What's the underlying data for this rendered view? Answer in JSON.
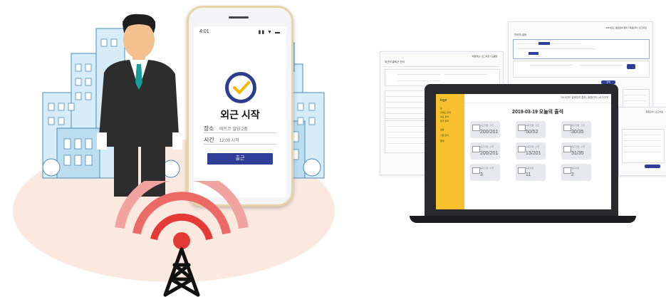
{
  "colors": {
    "ground": "#fbe9e0",
    "signal": "#e53935",
    "phone_accent": "#2f3f99",
    "sidebar": "#f6c12c",
    "building": "#cfe6f5",
    "building_outline": "#4a8bb8"
  },
  "phone": {
    "time": "4:01",
    "status_icons": "▮▮ ▼ ▬",
    "title": "외근 시작",
    "place_label": "장소",
    "place_value": "비트코 빌딩 2층",
    "time_label": "시간",
    "time_value": "12:00 시작",
    "button_label": "출근"
  },
  "laptop": {
    "logo": "logo",
    "topbar": "2019년도 설문참여 결과 | 회원관리 | 로그아웃",
    "date_title": "2019-03-19 오늘의 출석",
    "sidebar_items": [
      "홈",
      "출퇴근 관리",
      "외근 관리",
      "휴가 관리",
      "설정",
      "사원 관리",
      "통계"
    ],
    "cards": [
      {
        "title": "출근 현황 · 수업",
        "value": "200/201"
      },
      {
        "title": "지각 현황 · 수업",
        "value": "50/52"
      },
      {
        "title": "결근 현황 · 수업",
        "value": "30/35"
      },
      {
        "title": "퇴근 현황 · 수업",
        "value": "200/201"
      },
      {
        "title": "조퇴 현황 · 수업",
        "value": "13/201"
      },
      {
        "title": "외근 현황 · 수업",
        "value": "31/35"
      },
      {
        "title": "휴가 신청 · 수업",
        "value": "3"
      },
      {
        "title": "출장 현황",
        "value": "11"
      },
      {
        "title": "야근 현황",
        "value": "2"
      }
    ]
  },
  "docs": {
    "left_title": "외근자 출퇴근 관리",
    "left_nav": "회원정보 | 로그아웃 | 도움말",
    "top_title": "관리자 설정",
    "top_nav": "2019년도 설문참여 결과 | 회원관리 | 로그아웃",
    "right_nav": "회원관리 | 로그아웃",
    "search_button": "검색"
  }
}
